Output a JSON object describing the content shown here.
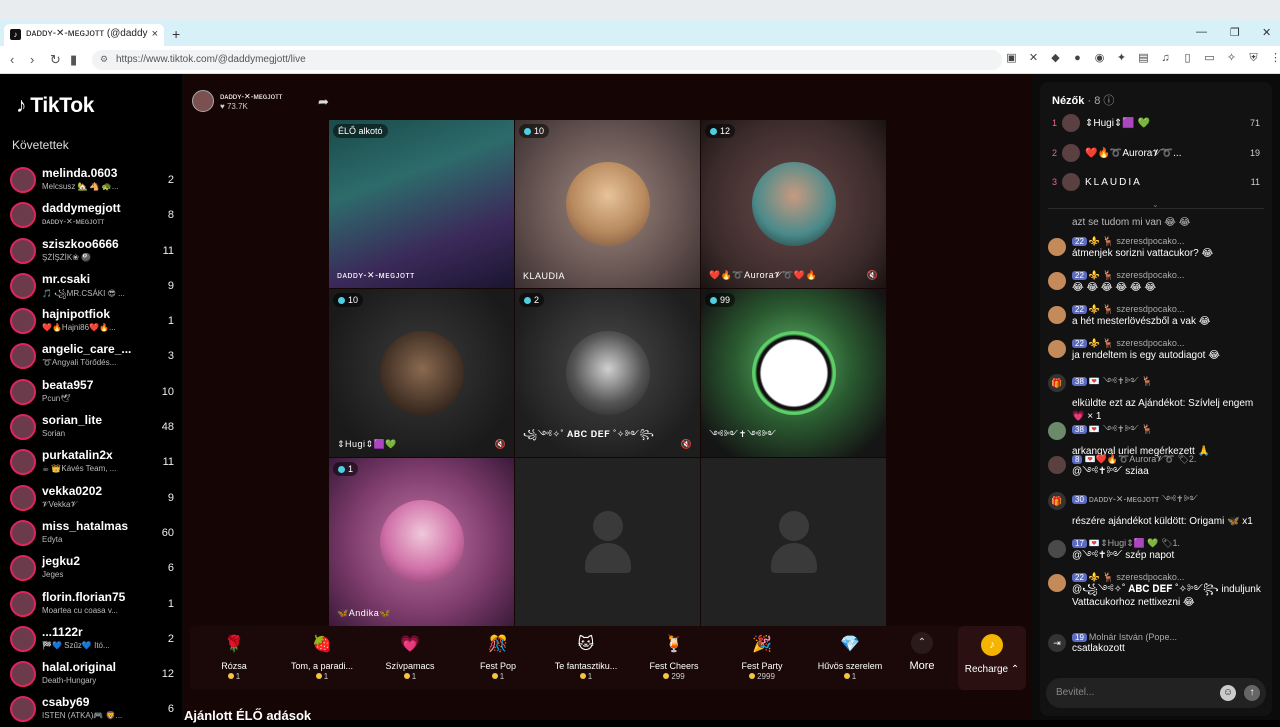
{
  "browser": {
    "tab_title": "ᴅᴀᴅᴅʏ-✕-ᴍᴇɢᴊᴏᴛᴛ (@daddy",
    "url": "https://www.tiktok.com/@daddymegjott/live",
    "new_tab": "+",
    "close_tab": "×"
  },
  "sidebar": {
    "logo": "TikTok",
    "follow_title": "Követettek",
    "items": [
      {
        "name": "melinda.0603",
        "sub": "Melcsusz 🏡 🐴 🐢...",
        "count": "2"
      },
      {
        "name": "daddymegjott",
        "sub": "ᴅᴀᴅᴅʏ-✕-ᴍᴇɢᴊᴏᴛᴛ",
        "count": "8"
      },
      {
        "name": "sziszkoo6666",
        "sub": "ŞŻİŞŻİK❀ 🎱",
        "count": "11"
      },
      {
        "name": "mr.csaki",
        "sub": "🎵 ꧁MR.CSÁKI 😎 ...",
        "count": "9"
      },
      {
        "name": "hajnipotfiok",
        "sub": "❤️🔥Hajni86❤️🔥...",
        "count": "1"
      },
      {
        "name": "angelic_care_...",
        "sub": "➰Angyali Törődés...",
        "count": "3"
      },
      {
        "name": "beata957",
        "sub": "Рсun🕊",
        "count": "10"
      },
      {
        "name": "sorian_lite",
        "sub": "Sorian",
        "count": "48"
      },
      {
        "name": "purkatalin2x",
        "sub": "☕ 👑Kávés Team, ...",
        "count": "11"
      },
      {
        "name": "vekka0202",
        "sub": "𝓥Vekka𝓥",
        "count": "9"
      },
      {
        "name": "miss_hatalmas",
        "sub": "Edyta",
        "count": "60"
      },
      {
        "name": "jegku2",
        "sub": "Jeges",
        "count": "6"
      },
      {
        "name": "florin.florian75",
        "sub": "Moartea cu coasa v...",
        "count": "1"
      },
      {
        "name": "...1122r",
        "sub": "🏁💙 Szűz💙 Itó...",
        "count": "2"
      },
      {
        "name": "halal.original",
        "sub": "Death-Hungary",
        "count": "12"
      },
      {
        "name": "csaby69",
        "sub": "ISTEN (ATKA)🎮 🦁...",
        "count": "6"
      }
    ]
  },
  "stream": {
    "host_name": "ᴅᴀᴅᴅʏ-✕-ᴍᴇɢᴊᴏᴛᴛ",
    "host_likes": "♥ 73.7K",
    "cells": [
      {
        "pill": "ÉLŐ alkotó",
        "name": "ᴅᴀᴅᴅʏ-✕-ᴍᴇɢᴊᴏᴛᴛ",
        "mute": ""
      },
      {
        "pill": "10",
        "name": "KLAUDIA",
        "mute": ""
      },
      {
        "pill": "12",
        "name": "❤️🔥➰Aurora𝓥➰❤️🔥",
        "mute": "🔇"
      },
      {
        "pill": "10",
        "name": "⇕Hugi⇕🟪💚",
        "mute": "🔇"
      },
      {
        "pill": "2",
        "name": "꧁༺✧˚ 𝐀𝐁𝐂 𝐃𝐄𝐅 ˚✧༻꧂",
        "mute": "🔇"
      },
      {
        "pill": "99",
        "name": "༺༻✝༺༻",
        "mute": ""
      },
      {
        "pill": "1",
        "name": "🦋Andika🦋",
        "mute": ""
      }
    ],
    "gifts": [
      {
        "name": "Rózsa",
        "price": "1",
        "icon": "🌹"
      },
      {
        "name": "Tom, a paradi...",
        "price": "1",
        "icon": "🍓"
      },
      {
        "name": "Szívpamacs",
        "price": "1",
        "icon": "💗"
      },
      {
        "name": "Fest Pop",
        "price": "1",
        "icon": "🎊"
      },
      {
        "name": "Te fantasztiku...",
        "price": "1",
        "icon": "🐱"
      },
      {
        "name": "Fest Cheers",
        "price": "299",
        "icon": "🍹"
      },
      {
        "name": "Fest Party",
        "price": "2999",
        "icon": "🎉"
      },
      {
        "name": "Hűvös szerelem",
        "price": "1",
        "icon": "💎"
      }
    ],
    "more_label": "More",
    "recharge_label": "Recharge ⌃",
    "recommended": "Ajánlott ÉLŐ adások"
  },
  "chat": {
    "viewers_label": "Nézők",
    "viewers_count": "· 8",
    "top_viewers": [
      {
        "rank": "1",
        "name": "⇕Hugi⇕🟪 💚",
        "score": "71"
      },
      {
        "rank": "2",
        "name": "❤️🔥➰Aurora𝓥➰...",
        "score": "19"
      },
      {
        "rank": "3",
        "name": "KLAUDIA",
        "score": "11"
      }
    ],
    "messages": [
      {
        "type": "plain",
        "text": "azt se tudom mi van 😂 😂"
      },
      {
        "type": "msg",
        "badge": "22",
        "user": "⚜️ 🦌 szeresdpocako...",
        "text": "átmenjek sorizni vattacukor? 😂"
      },
      {
        "type": "msg",
        "badge": "22",
        "user": "⚜️ 🦌 szeresdpocako...",
        "text": "😂 😂 😂 😂 😂 😂"
      },
      {
        "type": "msg",
        "badge": "22",
        "user": "⚜️ 🦌 szeresdpocako...",
        "text": "a hét mesterlövészből a vak 😂"
      },
      {
        "type": "msg",
        "badge": "22",
        "user": "⚜️ 🦌 szeresdpocako...",
        "text": "ja rendeltem is egy autodiagot 😂"
      },
      {
        "type": "gift",
        "badge": "38",
        "user": "💌 ༺✝༻ 🦌",
        "text": "elküldte ezt az Ajándékot: Szívlelj engem 💗 × 1"
      },
      {
        "type": "msg",
        "badge": "38",
        "user": "💌 ༺✝༻ 🦌",
        "text": "arkangyal uriel megérkezett 🙏"
      },
      {
        "type": "msg",
        "badge": "8",
        "user": "💌❤️🔥➰Aurora𝓥➰ 🏷2.",
        "text": "@༺✝༻ sziaa"
      },
      {
        "type": "gift",
        "badge": "30",
        "user": "ᴅᴀᴅᴅʏ-✕-ᴍᴇɢᴊᴏᴛᴛ ༺✝༻",
        "text": "részére ajándékot küldött: Origami 🦋 x1"
      },
      {
        "type": "msg",
        "badge": "17",
        "user": "💌⇕Hugi⇕🟪 💚 🏷1.",
        "text": "@༺✝༻ szép napot"
      },
      {
        "type": "msg",
        "badge": "22",
        "user": "⚜️ 🦌 szeresdpocako...",
        "text": "@꧁༺✧˚ 𝐀𝐁𝐂 𝐃𝐄𝐅 ˚✧༻꧂ induljunk Vattacukorhoz nettixezni 😂"
      },
      {
        "type": "join",
        "badge": "19",
        "user": "Molnár István (Pope...",
        "text": "csatlakozott"
      }
    ],
    "input_placeholder": "Bevitel..."
  },
  "colors": {
    "accent": "#e0245e",
    "coin": "#f4c542",
    "live_dot": "#4dd0e1"
  }
}
